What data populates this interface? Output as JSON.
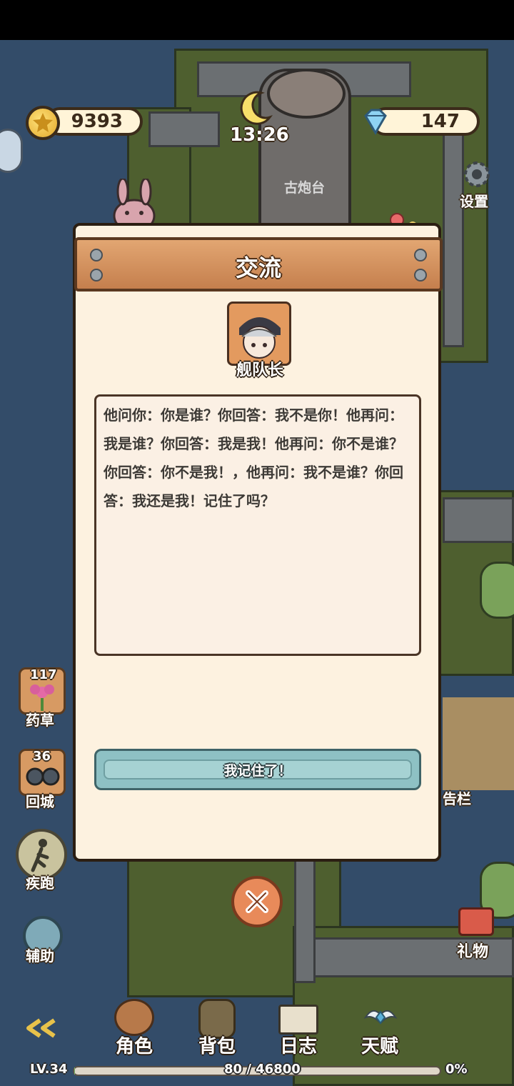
{
  "hud": {
    "coins": "9393",
    "time": "13:26",
    "diamonds": "147",
    "settings_label": "设置",
    "cannon_label": "古炮台"
  },
  "map_labels": {
    "notice_board": "告栏",
    "gift": "礼物"
  },
  "side": {
    "herb": {
      "count": "117",
      "label": "药草"
    },
    "return_city": {
      "count": "36",
      "label": "回城"
    },
    "sprint": {
      "label": "疾跑"
    },
    "assist": {
      "label": "辅助"
    }
  },
  "dialog": {
    "title": "交流",
    "npc_name": "舰队长",
    "message": "他问你：你是谁？你回答：我不是你！他再问：我是谁？你回答：我是我！他再问：你不是谁？你回答：你不是我！，他再问：我不是谁？你回答：我还是我！记住了吗？",
    "answer": "我记住了！"
  },
  "bottom_nav": {
    "role": "角色",
    "bag": "背包",
    "journal": "日志",
    "talent": "天赋"
  },
  "level": {
    "label": "LV.34",
    "xp_text": "80 / 46800",
    "percent_text": "0%",
    "progress_fraction": 0.0017
  },
  "colors": {
    "sea": "#334c69",
    "grass": "#4e5f2f",
    "dialog_bg": "#fdf2e0",
    "header_wood": "#d18f5d",
    "answer_button": "#8ec1c4"
  },
  "icons": [
    "coin-icon",
    "moon-icon",
    "diamond-icon",
    "gear-icon",
    "flower-icon",
    "binoculars-icon",
    "runner-icon",
    "assist-icon",
    "close-icon",
    "back-arrows-icon",
    "role-icon",
    "bag-icon",
    "journal-icon",
    "talent-icon",
    "gift-icon"
  ]
}
